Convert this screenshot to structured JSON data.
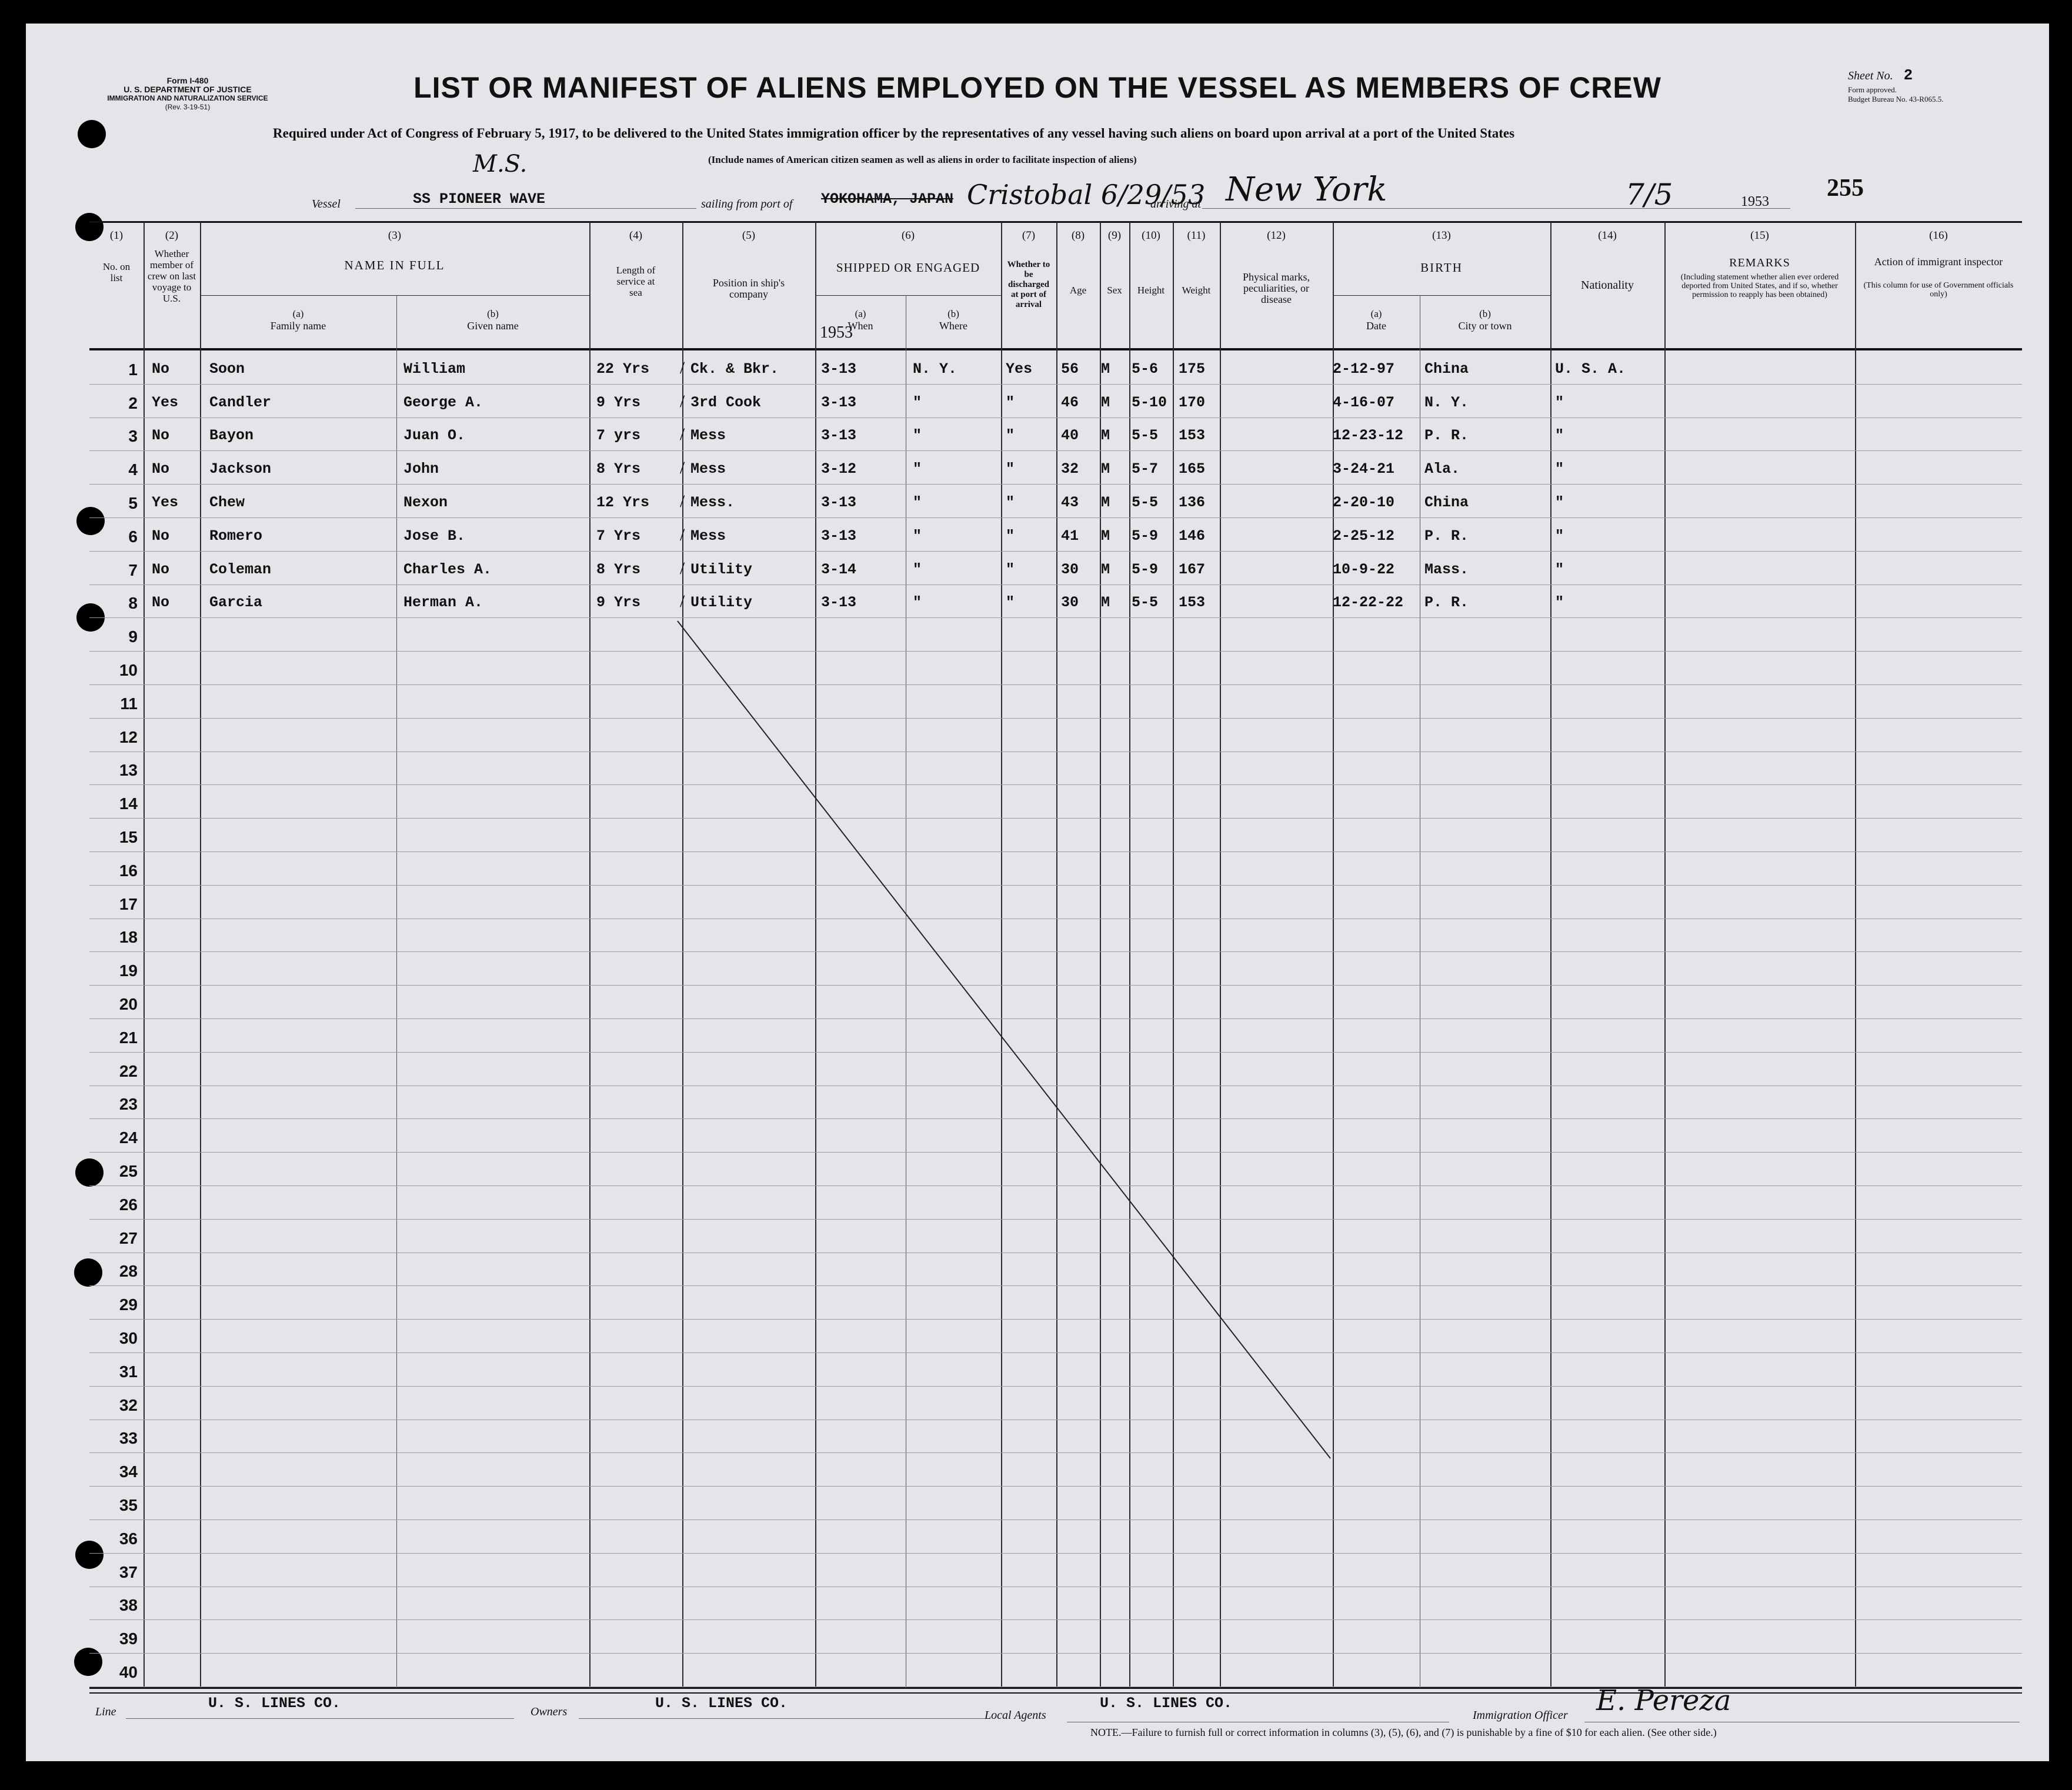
{
  "form": {
    "id": "Form I-480",
    "dept": "U. S. DEPARTMENT OF JUSTICE",
    "service": "IMMIGRATION AND NATURALIZATION SERVICE",
    "rev": "(Rev. 3-19-51)"
  },
  "title": "LIST OR MANIFEST OF ALIENS EMPLOYED ON THE VESSEL AS MEMBERS OF CREW",
  "subtitle": "Required under Act of Congress of February 5, 1917, to be delivered to the United States immigration officer by the representatives of any vessel having such aliens on board upon arrival at a port of the United States",
  "subtitle2": "(Include names of American citizen seamen as well as aliens in order to facilitate inspection of aliens)",
  "sheet": {
    "label": "Sheet No.",
    "value": "2",
    "approved": "Form approved.",
    "budget": "Budget Bureau No. 43-R065.5."
  },
  "header_fields": {
    "vessel_label": "Vessel",
    "vessel_value": "SS PIONEER WAVE",
    "vessel_note": "M.S.",
    "sailing_label": "sailing from port of",
    "sailing_value": "YOKOHAMA, JAPAN",
    "sailing_hand": "Cristobal 6/29/53",
    "arriving_label": "arriving at",
    "arriving_hand": "New York",
    "date_hand": "7/5",
    "year": "1953",
    "stamp": "255"
  },
  "columns": {
    "c1": {
      "num": "(1)",
      "label": "No. on list"
    },
    "c2": {
      "num": "(2)",
      "label": "Whether member of crew on last voyage to U.S."
    },
    "c3": {
      "num": "(3)",
      "label": "NAME IN FULL",
      "a_label": "(a)",
      "a": "Family name",
      "b_label": "(b)",
      "b": "Given name"
    },
    "c4": {
      "num": "(4)",
      "label": "Length of service at sea"
    },
    "c5": {
      "num": "(5)",
      "label": "Position in ship's company"
    },
    "c6": {
      "num": "(6)",
      "label": "SHIPPED OR ENGAGED",
      "a_label": "(a)",
      "a": "When",
      "b_label": "(b)",
      "b": "Where",
      "year": "1953"
    },
    "c7": {
      "num": "(7)",
      "label": "Whether to be discharged at port of arrival"
    },
    "c8": {
      "num": "(8)",
      "label": "Age"
    },
    "c9": {
      "num": "(9)",
      "label": "Sex"
    },
    "c10": {
      "num": "(10)",
      "label": "Height"
    },
    "c11": {
      "num": "(11)",
      "label": "Weight"
    },
    "c12": {
      "num": "(12)",
      "label": "Physical marks, peculiarities, or disease"
    },
    "c13": {
      "num": "(13)",
      "label": "BIRTH",
      "a_label": "(a)",
      "a": "Date",
      "b_label": "(b)",
      "b": "City or town"
    },
    "c14": {
      "num": "(14)",
      "label": "Nationality"
    },
    "c15": {
      "num": "(15)",
      "label": "REMARKS",
      "sub": "(Including statement whether alien ever ordered deported from United States, and if so, whether permission to reapply has been obtained)"
    },
    "c16": {
      "num": "(16)",
      "label": "Action of immigrant inspector",
      "sub": "(This column for use of Government officials only)"
    }
  },
  "rows": [
    {
      "n": "1",
      "prev": "No",
      "family": "Soon",
      "given": "William",
      "service": "22 Yrs",
      "position": "Ck. & Bkr.",
      "when": "3-13",
      "where": "N. Y.",
      "disch": "Yes",
      "age": "56",
      "sex": "M",
      "height": "5-6",
      "weight": "175",
      "bdate": "2-12-97",
      "bcity": "China",
      "nat": "U. S. A."
    },
    {
      "n": "2",
      "prev": "Yes",
      "family": "Candler",
      "given": "George A.",
      "service": "9 Yrs",
      "position": "3rd Cook",
      "when": "3-13",
      "where": "\"",
      "disch": "\"",
      "age": "46",
      "sex": "M",
      "height": "5-10",
      "weight": "170",
      "bdate": "4-16-07",
      "bcity": "N. Y.",
      "nat": "\""
    },
    {
      "n": "3",
      "prev": "No",
      "family": "Bayon",
      "given": "Juan O.",
      "service": "7 yrs",
      "position": "Mess",
      "when": "3-13",
      "where": "\"",
      "disch": "\"",
      "age": "40",
      "sex": "M",
      "height": "5-5",
      "weight": "153",
      "bdate": "12-23-12",
      "bcity": "P. R.",
      "nat": "\""
    },
    {
      "n": "4",
      "prev": "No",
      "family": "Jackson",
      "given": "John",
      "service": "8 Yrs",
      "position": "Mess",
      "when": "3-12",
      "where": "\"",
      "disch": "\"",
      "age": "32",
      "sex": "M",
      "height": "5-7",
      "weight": "165",
      "bdate": "3-24-21",
      "bcity": "Ala.",
      "nat": "\""
    },
    {
      "n": "5",
      "prev": "Yes",
      "family": "Chew",
      "given": "Nexon",
      "service": "12 Yrs",
      "position": "Mess.",
      "when": "3-13",
      "where": "\"",
      "disch": "\"",
      "age": "43",
      "sex": "M",
      "height": "5-5",
      "weight": "136",
      "bdate": "2-20-10",
      "bcity": "China",
      "nat": "\""
    },
    {
      "n": "6",
      "prev": "No",
      "family": "Romero",
      "given": "Jose B.",
      "service": "7 Yrs",
      "position": "Mess",
      "when": "3-13",
      "where": "\"",
      "disch": "\"",
      "age": "41",
      "sex": "M",
      "height": "5-9",
      "weight": "146",
      "bdate": "2-25-12",
      "bcity": "P. R.",
      "nat": "\""
    },
    {
      "n": "7",
      "prev": "No",
      "family": "Coleman",
      "given": "Charles A.",
      "service": "8 Yrs",
      "position": "Utility",
      "when": "3-14",
      "where": "\"",
      "disch": "\"",
      "age": "30",
      "sex": "M",
      "height": "5-9",
      "weight": "167",
      "bdate": "10-9-22",
      "bcity": "Mass.",
      "nat": "\""
    },
    {
      "n": "8",
      "prev": "No",
      "family": "Garcia",
      "given": "Herman A.",
      "service": "9 Yrs",
      "position": "Utility",
      "when": "3-13",
      "where": "\"",
      "disch": "\"",
      "age": "30",
      "sex": "M",
      "height": "5-5",
      "weight": "153",
      "bdate": "12-22-22",
      "bcity": "P. R.",
      "nat": "\""
    }
  ],
  "row_numbers": [
    "1",
    "2",
    "3",
    "4",
    "5",
    "6",
    "7",
    "8",
    "9",
    "10",
    "11",
    "12",
    "13",
    "14",
    "15",
    "16",
    "17",
    "18",
    "19",
    "20",
    "21",
    "22",
    "23",
    "24",
    "25",
    "26",
    "27",
    "28",
    "29",
    "30",
    "31",
    "32",
    "33",
    "34",
    "35",
    "36",
    "37",
    "38",
    "39",
    "40"
  ],
  "footer": {
    "line_label": "Line",
    "line_value": "U. S. LINES CO.",
    "owners_label": "Owners",
    "owners_value": "U. S. LINES CO.",
    "agents_label": "Local Agents",
    "agents_value": "U. S. LINES CO.",
    "officer_label": "Immigration Officer",
    "officer_sig": "E. Pereza",
    "note": "NOTE.—Failure to furnish full or correct information in columns (3), (5), (6), and (7) is punishable by a fine of $10 for each alien. (See other side.)"
  }
}
